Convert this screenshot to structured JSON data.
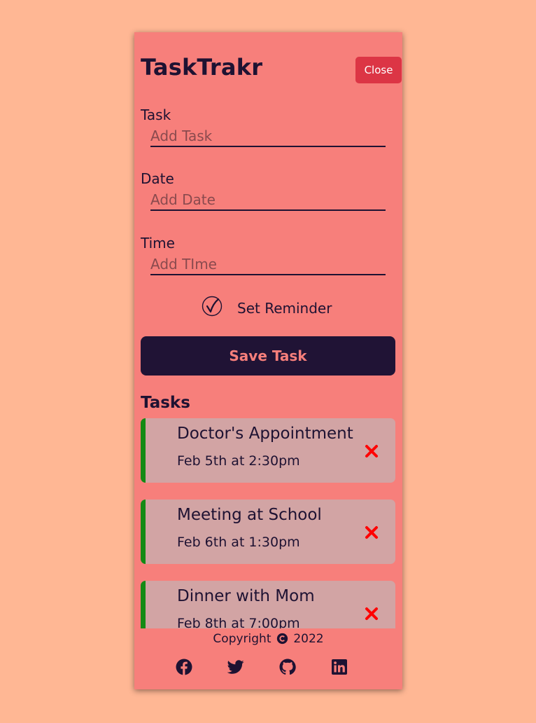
{
  "colors": {
    "page_bg": "#ffb794",
    "card_bg": "#f77f7b",
    "accent_dark": "#201335",
    "close_red": "#dc3545",
    "task_bg": "#d2a4a4",
    "reminder_border": "#148a14",
    "delete_red": "#ff0000"
  },
  "header": {
    "title": "TaskTrakr",
    "close_label": "Close"
  },
  "form": {
    "task": {
      "label": "Task",
      "placeholder": "Add Task"
    },
    "date": {
      "label": "Date",
      "placeholder": "Add Date"
    },
    "time": {
      "label": "Time",
      "placeholder": "Add TIme"
    },
    "reminder_label": "Set Reminder",
    "reminder_checked": true,
    "save_label": "Save Task"
  },
  "tasks_heading": "Tasks",
  "tasks": [
    {
      "title": "Doctor's Appointment",
      "date": "Feb 5th at 2:30pm",
      "reminder": true,
      "delete_icon": "close-icon"
    },
    {
      "title": "Meeting at School",
      "date": "Feb 6th at 1:30pm",
      "reminder": true,
      "delete_icon": "close-icon"
    },
    {
      "title": "Dinner with Mom",
      "date": "Feb 8th at 7:00pm",
      "reminder": true,
      "delete_icon": "close-icon"
    }
  ],
  "footer": {
    "copyright_prefix": "Copyright",
    "copyright_year": "2022",
    "social_icons": [
      "facebook-icon",
      "twitter-icon",
      "github-icon",
      "linkedin-icon"
    ]
  }
}
